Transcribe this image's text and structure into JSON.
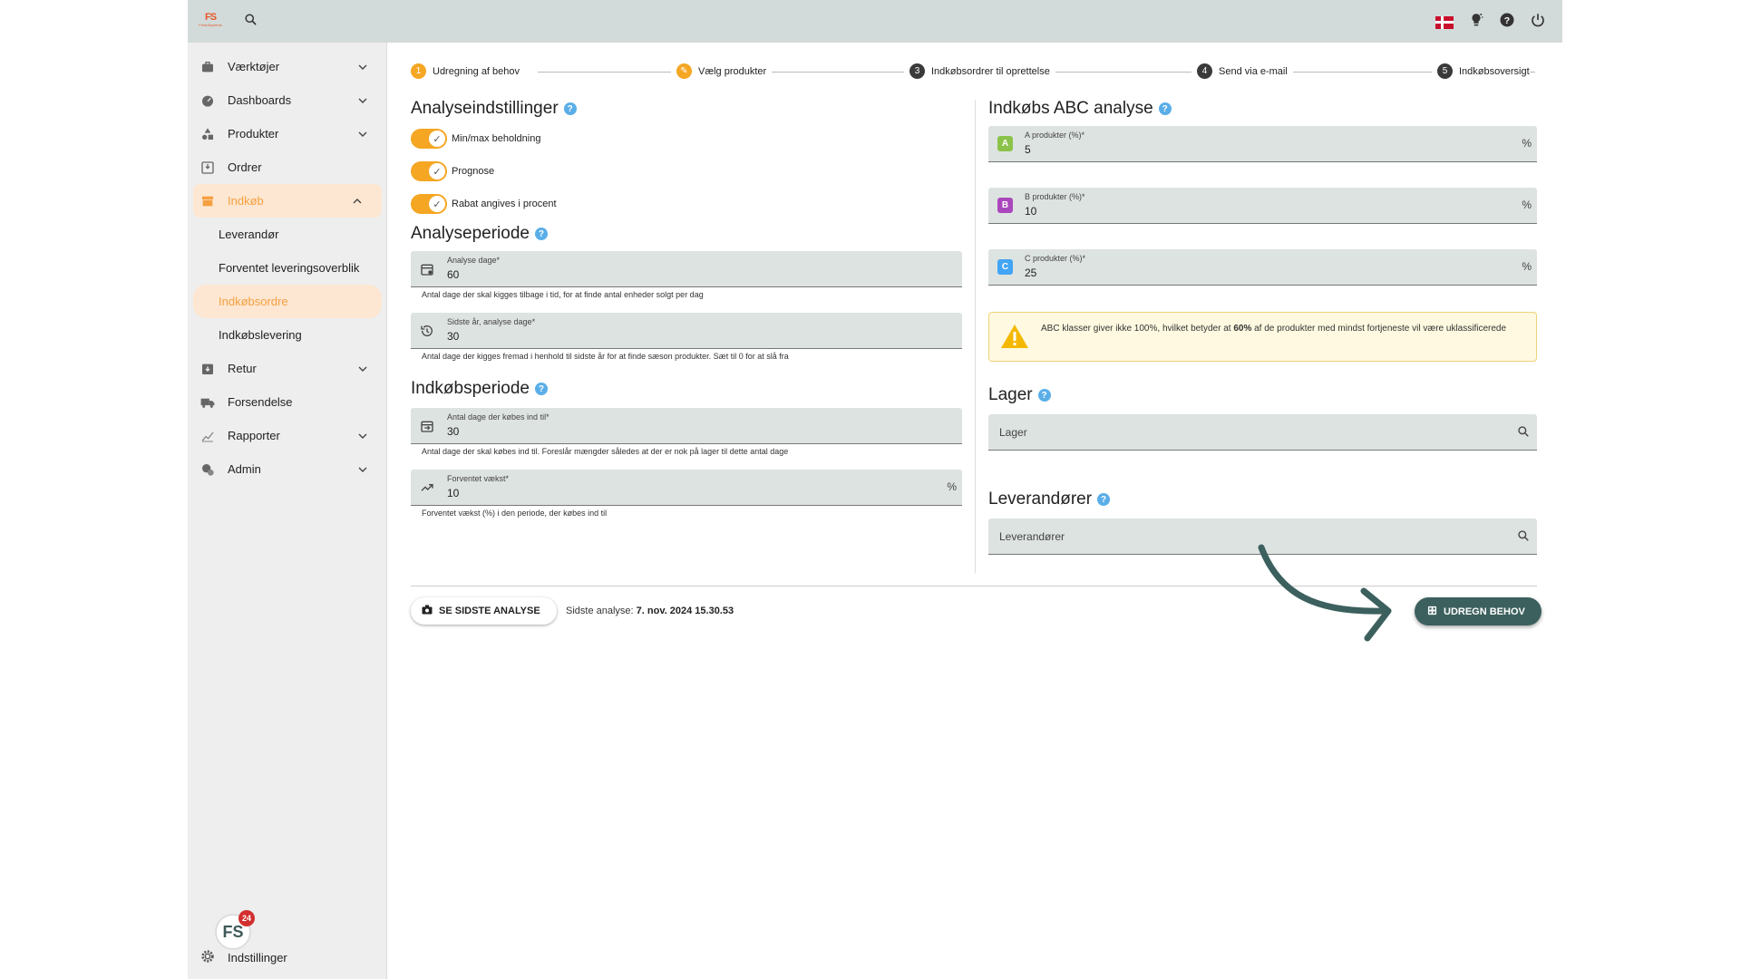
{
  "logo": {
    "mark": "FS",
    "sub": "FreshSystems"
  },
  "sidebar": {
    "items": [
      {
        "label": "Værktøjer"
      },
      {
        "label": "Dashboards"
      },
      {
        "label": "Produkter"
      },
      {
        "label": "Ordrer"
      },
      {
        "label": "Indkøb"
      },
      {
        "label": "Retur"
      },
      {
        "label": "Forsendelse"
      },
      {
        "label": "Rapporter"
      },
      {
        "label": "Admin"
      }
    ],
    "sub_items": [
      {
        "label": "Leverandør"
      },
      {
        "label": "Forventet leveringsoverblik"
      },
      {
        "label": "Indkøbsordre"
      },
      {
        "label": "Indkøbslevering"
      }
    ],
    "settings_label": "Indstillinger",
    "badge_text": "FS",
    "badge_count": "24"
  },
  "stepper": {
    "steps": [
      {
        "num": "1",
        "label": "Udregning af behov"
      },
      {
        "num": "✎",
        "label": "Vælg produkter"
      },
      {
        "num": "3",
        "label": "Indkøbsordrer til oprettelse"
      },
      {
        "num": "4",
        "label": "Send via e-mail"
      },
      {
        "num": "5",
        "label": "Indkøbsoversigt"
      }
    ]
  },
  "analysis_settings": {
    "title": "Analyseindstillinger",
    "toggles": [
      {
        "label": "Min/max beholdning",
        "on": true
      },
      {
        "label": "Prognose",
        "on": true
      },
      {
        "label": "Rabat angives i procent",
        "on": true
      }
    ]
  },
  "analysis_period": {
    "title": "Analyseperiode",
    "fields": [
      {
        "label": "Analyse dage*",
        "value": "60",
        "hint": "Antal dage der skal kigges tilbage i tid, for at finde antal enheder solgt per dag"
      },
      {
        "label": "Sidste år, analyse dage*",
        "value": "30",
        "hint": "Antal dage der kigges fremad i henhold til sidste år for at finde sæson produkter. Sæt til 0 for at slå fra"
      }
    ]
  },
  "purchase_period": {
    "title": "Indkøbsperiode",
    "fields": [
      {
        "label": "Antal dage der købes ind til*",
        "value": "30",
        "hint": "Antal dage der skal købes ind til. Foreslår mængder således at der er nok på lager til dette antal dage"
      },
      {
        "label": "Forventet vækst*",
        "value": "10",
        "unit": "%",
        "hint": "Forventet vækst (%) i den periode, der købes ind til"
      }
    ]
  },
  "abc": {
    "title": "Indkøbs ABC analyse",
    "fields": [
      {
        "badge": "A",
        "color": "#8bc34a",
        "label": "A produkter (%)*",
        "value": "5",
        "unit": "%"
      },
      {
        "badge": "B",
        "color": "#ab47bc",
        "label": "B produkter (%)*",
        "value": "10",
        "unit": "%"
      },
      {
        "badge": "C",
        "color": "#42a5f5",
        "label": "C produkter (%)*",
        "value": "25",
        "unit": "%"
      }
    ],
    "warning_pre": "ABC klasser giver ikke 100%, hvilket betyder at ",
    "warning_bold": "60%",
    "warning_post": " af de produkter med mindst fortjeneste vil være uklassificerede"
  },
  "lager": {
    "title": "Lager",
    "placeholder": "Lager"
  },
  "suppliers": {
    "title": "Leverandører",
    "placeholder": "Leverandører"
  },
  "footer": {
    "see_last_label": "SE SIDSTE ANALYSE",
    "last_analysis_label": "Sidste analyse:",
    "last_analysis_value": "7. nov. 2024 15.30.53",
    "calculate_label": "UDREGN BEHOV"
  },
  "colors": {
    "accent": "#f5a623",
    "primary": "#3c605e",
    "topbar": "#d2dbd9"
  }
}
